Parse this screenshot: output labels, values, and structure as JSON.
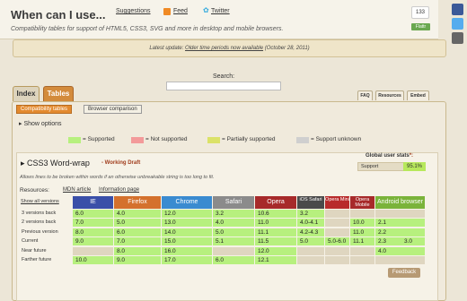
{
  "header": {
    "title": "When can I use...",
    "suggestions": "Suggestions",
    "feed": "Feed",
    "twitter": "Twitter",
    "tagline": "Compatibility tables for support of HTML5, CSS3, SVG and more in desktop and mobile browsers.",
    "counter": "133",
    "flattr": "Flattr"
  },
  "update": {
    "prefix": "Latest update: ",
    "link": "Older time periods now available",
    "date": " (October 28, 2011)"
  },
  "search": {
    "label": "Search:",
    "value": ""
  },
  "tabs": {
    "index": "Index",
    "tables": "Tables"
  },
  "small_tabs": {
    "faq": "FAQ",
    "resources": "Resources",
    "embed": "Embed"
  },
  "subtabs": {
    "compat": "Compatibility tables",
    "comparison": "Browser comparison"
  },
  "options": {
    "show": "Show options"
  },
  "legend": [
    {
      "label": "= Supported",
      "color": "#b7f07e"
    },
    {
      "label": "= Not supported",
      "color": "#f39a9a"
    },
    {
      "label": "= Partially supported",
      "color": "#dbe268"
    },
    {
      "label": "= Support unknown",
      "color": "#cfcfcf"
    }
  ],
  "feature": {
    "title": "CSS3 Word-wrap",
    "status": "- Working Draft",
    "description": "Allows lines to be broken within words if an otherwise unbreakable string is too long to fit.",
    "global_label": "Global user stats",
    "global_asterisk": "*:",
    "support_label": "Support",
    "support_value": "95.1%",
    "resources_label": "Resources:",
    "resource_links": [
      "MDN article",
      "Information page"
    ],
    "show_all": "Show all versions",
    "feedback": "Feedback"
  },
  "table": {
    "browsers": [
      {
        "name": "IE",
        "color": "#3a4fa8"
      },
      {
        "name": "Firefox",
        "color": "#d4712d"
      },
      {
        "name": "Chrome",
        "color": "#3a8bd0"
      },
      {
        "name": "Safari",
        "color": "#8b8b8b"
      },
      {
        "name": "Opera",
        "color": "#a72a2a"
      },
      {
        "name": "iOS Safari",
        "color": "#4a4a4a"
      },
      {
        "name": "Opera Mini",
        "color": "#b82b2b"
      },
      {
        "name": "Opera Mobile",
        "color": "#a72a2a"
      },
      {
        "name": "Android browser",
        "color": "#7ab33a"
      }
    ],
    "rows": [
      {
        "label": "3 versions back",
        "cells": [
          "6.0",
          "4.0",
          "12.0",
          "3.2",
          "10.6",
          "3.2",
          "",
          "",
          ""
        ]
      },
      {
        "label": "2 versions back",
        "cells": [
          "7.0",
          "5.0",
          "13.0",
          "4.0",
          "11.0",
          "4.0-4.1",
          "",
          "10.0",
          "2.1"
        ]
      },
      {
        "label": "Previous version",
        "cells": [
          "8.0",
          "6.0",
          "14.0",
          "5.0",
          "11.1",
          "4.2-4.3",
          "",
          "11.0",
          "2.2"
        ]
      },
      {
        "label": "Current",
        "cells": [
          "9.0",
          "7.0",
          "15.0",
          "5.1",
          "11.5",
          "5.0",
          "5.0-6.0",
          "11.1",
          "2.3"
        ],
        "extra": "3.0"
      },
      {
        "label": "Near future",
        "cells": [
          "",
          "8.0",
          "16.0",
          "",
          "12.0",
          "",
          "",
          "",
          "4.0"
        ]
      },
      {
        "label": "Farther future",
        "cells": [
          "10.0",
          "9.0",
          "17.0",
          "6.0",
          "12.1",
          "",
          "",
          "",
          ""
        ]
      }
    ]
  }
}
